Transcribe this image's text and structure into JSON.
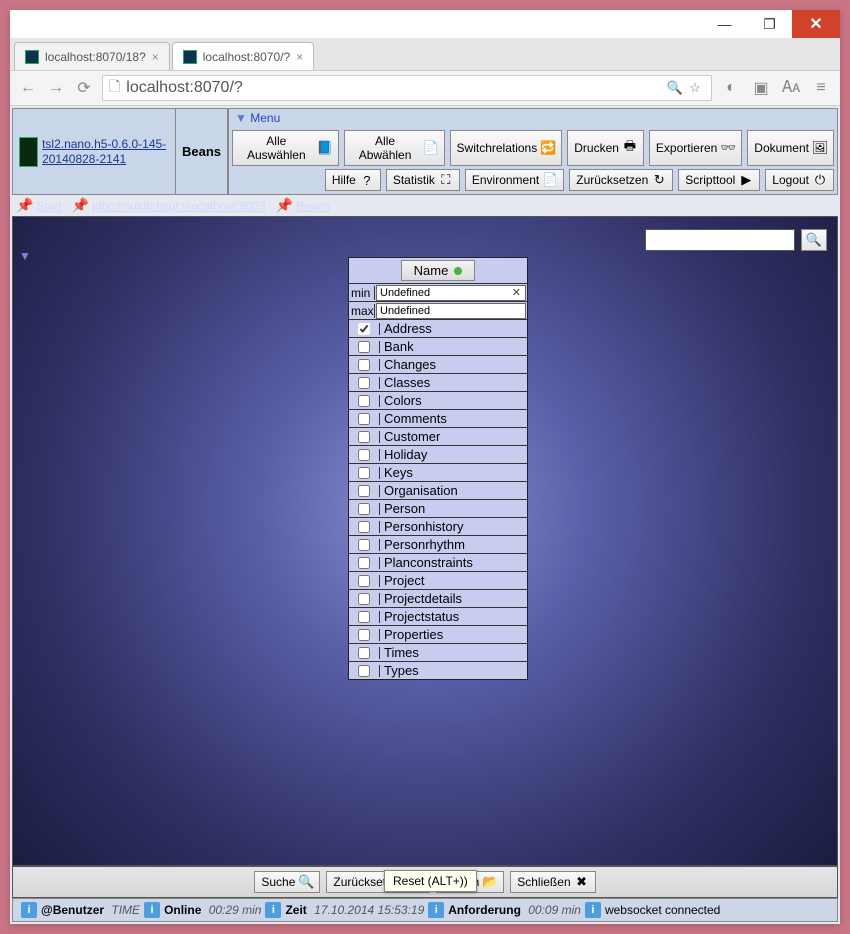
{
  "window": {
    "minimize": "—",
    "maximize": "❐",
    "close": "✕"
  },
  "browser": {
    "tabs": [
      {
        "label": "localhost:8070/18?",
        "active": false
      },
      {
        "label": "localhost:8070/?",
        "active": true
      }
    ],
    "url": "localhost:8070/?"
  },
  "header": {
    "logo_link": "tsl2.nano.h5-0.6.0-145-20140828-2141",
    "beans_label": "Beans",
    "menu_label": "Menu",
    "menu_row1": [
      {
        "id": "select-all",
        "label": "Alle Auswählen",
        "icon": "📘"
      },
      {
        "id": "deselect-all",
        "label": "Alle Abwählen",
        "icon": "📄"
      },
      {
        "id": "switch-relations",
        "label": "Switchrelations",
        "icon": "🔁"
      },
      {
        "id": "print",
        "label": "Drucken",
        "icon": "🖶"
      },
      {
        "id": "export",
        "label": "Exportieren",
        "icon": "👓"
      },
      {
        "id": "document",
        "label": "Dokument",
        "icon": "🖼"
      }
    ],
    "menu_row2": [
      {
        "id": "help",
        "label": "Hilfe",
        "icon": "?"
      },
      {
        "id": "statistic",
        "label": "Statistik",
        "icon": "⛶"
      },
      {
        "id": "environment",
        "label": "Environment",
        "icon": "📄"
      },
      {
        "id": "reset",
        "label": "Zurücksetzen",
        "icon": "↻"
      },
      {
        "id": "scripttool",
        "label": "Scripttool",
        "icon": "▶"
      },
      {
        "id": "logout",
        "label": "Logout",
        "icon": "⏻"
      }
    ]
  },
  "breadcrumbs": [
    {
      "label": "Start",
      "href": "#"
    },
    {
      "label": "jdbc:hsqldb:hsql://localhost:9003",
      "href": "#"
    },
    {
      "label": "Beans",
      "href": "#"
    }
  ],
  "search_top": {
    "value": ""
  },
  "table": {
    "name_label": "Name",
    "min_label": "min",
    "max_label": "max",
    "min_value": "Undefined",
    "max_value": "Undefined",
    "rows": [
      {
        "label": "Address",
        "checked": true
      },
      {
        "label": "Bank",
        "checked": false
      },
      {
        "label": "Changes",
        "checked": false
      },
      {
        "label": "Classes",
        "checked": false
      },
      {
        "label": "Colors",
        "checked": false
      },
      {
        "label": "Comments",
        "checked": false
      },
      {
        "label": "Customer",
        "checked": false
      },
      {
        "label": "Holiday",
        "checked": false
      },
      {
        "label": "Keys",
        "checked": false
      },
      {
        "label": "Organisation",
        "checked": false
      },
      {
        "label": "Person",
        "checked": false
      },
      {
        "label": "Personhistory",
        "checked": false
      },
      {
        "label": "Personrhythm",
        "checked": false
      },
      {
        "label": "Planconstraints",
        "checked": false
      },
      {
        "label": "Project",
        "checked": false
      },
      {
        "label": "Projectdetails",
        "checked": false
      },
      {
        "label": "Projectstatus",
        "checked": false
      },
      {
        "label": "Properties",
        "checked": false
      },
      {
        "label": "Times",
        "checked": false
      },
      {
        "label": "Types",
        "checked": false
      }
    ]
  },
  "bottom_actions": [
    {
      "id": "search",
      "label": "Suche",
      "icon": "🔍"
    },
    {
      "id": "reset",
      "label": "Zurücksetzen",
      "icon": "↻"
    },
    {
      "id": "open",
      "label": "Öffnen",
      "icon": "📂"
    },
    {
      "id": "close",
      "label": "Schließen",
      "icon": "✖"
    }
  ],
  "tooltip": "Reset (ALT+))",
  "status": {
    "user_label": "@Benutzer",
    "user_value": "TIME",
    "online_label": "Online",
    "online_value": "00:29 min",
    "time_label": "Zeit",
    "time_value": "17.10.2014 15:53:19",
    "request_label": "Anforderung",
    "request_value": "00:09 min",
    "ws_label": "websocket connected"
  }
}
